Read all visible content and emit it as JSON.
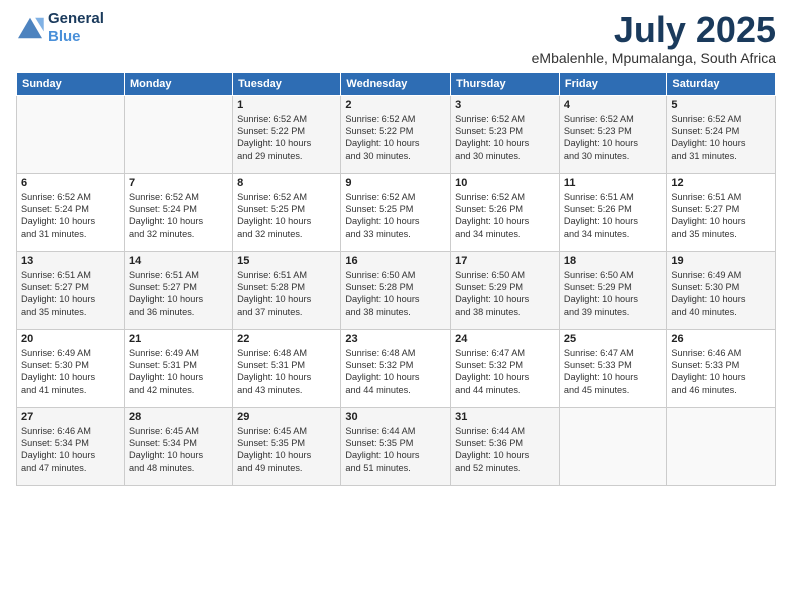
{
  "header": {
    "logo_line1": "General",
    "logo_line2": "Blue",
    "month": "July 2025",
    "location": "eMbalenhle, Mpumalanga, South Africa"
  },
  "weekdays": [
    "Sunday",
    "Monday",
    "Tuesday",
    "Wednesday",
    "Thursday",
    "Friday",
    "Saturday"
  ],
  "weeks": [
    [
      {
        "day": "",
        "detail": ""
      },
      {
        "day": "",
        "detail": ""
      },
      {
        "day": "1",
        "detail": "Sunrise: 6:52 AM\nSunset: 5:22 PM\nDaylight: 10 hours\nand 29 minutes."
      },
      {
        "day": "2",
        "detail": "Sunrise: 6:52 AM\nSunset: 5:22 PM\nDaylight: 10 hours\nand 30 minutes."
      },
      {
        "day": "3",
        "detail": "Sunrise: 6:52 AM\nSunset: 5:23 PM\nDaylight: 10 hours\nand 30 minutes."
      },
      {
        "day": "4",
        "detail": "Sunrise: 6:52 AM\nSunset: 5:23 PM\nDaylight: 10 hours\nand 30 minutes."
      },
      {
        "day": "5",
        "detail": "Sunrise: 6:52 AM\nSunset: 5:24 PM\nDaylight: 10 hours\nand 31 minutes."
      }
    ],
    [
      {
        "day": "6",
        "detail": "Sunrise: 6:52 AM\nSunset: 5:24 PM\nDaylight: 10 hours\nand 31 minutes."
      },
      {
        "day": "7",
        "detail": "Sunrise: 6:52 AM\nSunset: 5:24 PM\nDaylight: 10 hours\nand 32 minutes."
      },
      {
        "day": "8",
        "detail": "Sunrise: 6:52 AM\nSunset: 5:25 PM\nDaylight: 10 hours\nand 32 minutes."
      },
      {
        "day": "9",
        "detail": "Sunrise: 6:52 AM\nSunset: 5:25 PM\nDaylight: 10 hours\nand 33 minutes."
      },
      {
        "day": "10",
        "detail": "Sunrise: 6:52 AM\nSunset: 5:26 PM\nDaylight: 10 hours\nand 34 minutes."
      },
      {
        "day": "11",
        "detail": "Sunrise: 6:51 AM\nSunset: 5:26 PM\nDaylight: 10 hours\nand 34 minutes."
      },
      {
        "day": "12",
        "detail": "Sunrise: 6:51 AM\nSunset: 5:27 PM\nDaylight: 10 hours\nand 35 minutes."
      }
    ],
    [
      {
        "day": "13",
        "detail": "Sunrise: 6:51 AM\nSunset: 5:27 PM\nDaylight: 10 hours\nand 35 minutes."
      },
      {
        "day": "14",
        "detail": "Sunrise: 6:51 AM\nSunset: 5:27 PM\nDaylight: 10 hours\nand 36 minutes."
      },
      {
        "day": "15",
        "detail": "Sunrise: 6:51 AM\nSunset: 5:28 PM\nDaylight: 10 hours\nand 37 minutes."
      },
      {
        "day": "16",
        "detail": "Sunrise: 6:50 AM\nSunset: 5:28 PM\nDaylight: 10 hours\nand 38 minutes."
      },
      {
        "day": "17",
        "detail": "Sunrise: 6:50 AM\nSunset: 5:29 PM\nDaylight: 10 hours\nand 38 minutes."
      },
      {
        "day": "18",
        "detail": "Sunrise: 6:50 AM\nSunset: 5:29 PM\nDaylight: 10 hours\nand 39 minutes."
      },
      {
        "day": "19",
        "detail": "Sunrise: 6:49 AM\nSunset: 5:30 PM\nDaylight: 10 hours\nand 40 minutes."
      }
    ],
    [
      {
        "day": "20",
        "detail": "Sunrise: 6:49 AM\nSunset: 5:30 PM\nDaylight: 10 hours\nand 41 minutes."
      },
      {
        "day": "21",
        "detail": "Sunrise: 6:49 AM\nSunset: 5:31 PM\nDaylight: 10 hours\nand 42 minutes."
      },
      {
        "day": "22",
        "detail": "Sunrise: 6:48 AM\nSunset: 5:31 PM\nDaylight: 10 hours\nand 43 minutes."
      },
      {
        "day": "23",
        "detail": "Sunrise: 6:48 AM\nSunset: 5:32 PM\nDaylight: 10 hours\nand 44 minutes."
      },
      {
        "day": "24",
        "detail": "Sunrise: 6:47 AM\nSunset: 5:32 PM\nDaylight: 10 hours\nand 44 minutes."
      },
      {
        "day": "25",
        "detail": "Sunrise: 6:47 AM\nSunset: 5:33 PM\nDaylight: 10 hours\nand 45 minutes."
      },
      {
        "day": "26",
        "detail": "Sunrise: 6:46 AM\nSunset: 5:33 PM\nDaylight: 10 hours\nand 46 minutes."
      }
    ],
    [
      {
        "day": "27",
        "detail": "Sunrise: 6:46 AM\nSunset: 5:34 PM\nDaylight: 10 hours\nand 47 minutes."
      },
      {
        "day": "28",
        "detail": "Sunrise: 6:45 AM\nSunset: 5:34 PM\nDaylight: 10 hours\nand 48 minutes."
      },
      {
        "day": "29",
        "detail": "Sunrise: 6:45 AM\nSunset: 5:35 PM\nDaylight: 10 hours\nand 49 minutes."
      },
      {
        "day": "30",
        "detail": "Sunrise: 6:44 AM\nSunset: 5:35 PM\nDaylight: 10 hours\nand 51 minutes."
      },
      {
        "day": "31",
        "detail": "Sunrise: 6:44 AM\nSunset: 5:36 PM\nDaylight: 10 hours\nand 52 minutes."
      },
      {
        "day": "",
        "detail": ""
      },
      {
        "day": "",
        "detail": ""
      }
    ]
  ]
}
